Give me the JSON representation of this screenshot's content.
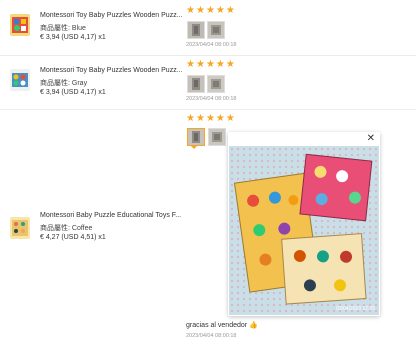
{
  "reviews": [
    {
      "product_title": "Montessori Toy Baby Puzzles Wooden Puzz...",
      "attr_label": "商品屬性:",
      "attr_value": "Blue",
      "price": "€ 3,94",
      "usd": "(USD  4,17)",
      "qty": "x1",
      "rating": 5,
      "date": "2023/04/04 08:00:18"
    },
    {
      "product_title": "Montessori Toy Baby Puzzles Wooden Puzz...",
      "attr_label": "商品屬性:",
      "attr_value": "Gray",
      "price": "€ 3,94",
      "usd": "(USD  4,17)",
      "qty": "x1",
      "rating": 5,
      "date": "2023/04/04 08:00:18"
    },
    {
      "product_title": "Montessori Baby Puzzle Educational Toys F...",
      "attr_label": "商品屬性:",
      "attr_value": "Coffee",
      "price": "€ 4,27",
      "usd": "(USD  4,51)",
      "qty": "x1",
      "rating": 5,
      "date": "2023/04/04 08:00:18",
      "review_text": "gracias al vendedor 👍"
    }
  ],
  "preview": {
    "close_label": "✕",
    "photo_timestamp": "03/04/2023  12:25"
  },
  "colors": {
    "star": "#f5a623",
    "divider": "#ececec",
    "accent_border": "#f5a623"
  },
  "icons": {
    "star": "star-icon",
    "close": "close-icon"
  }
}
